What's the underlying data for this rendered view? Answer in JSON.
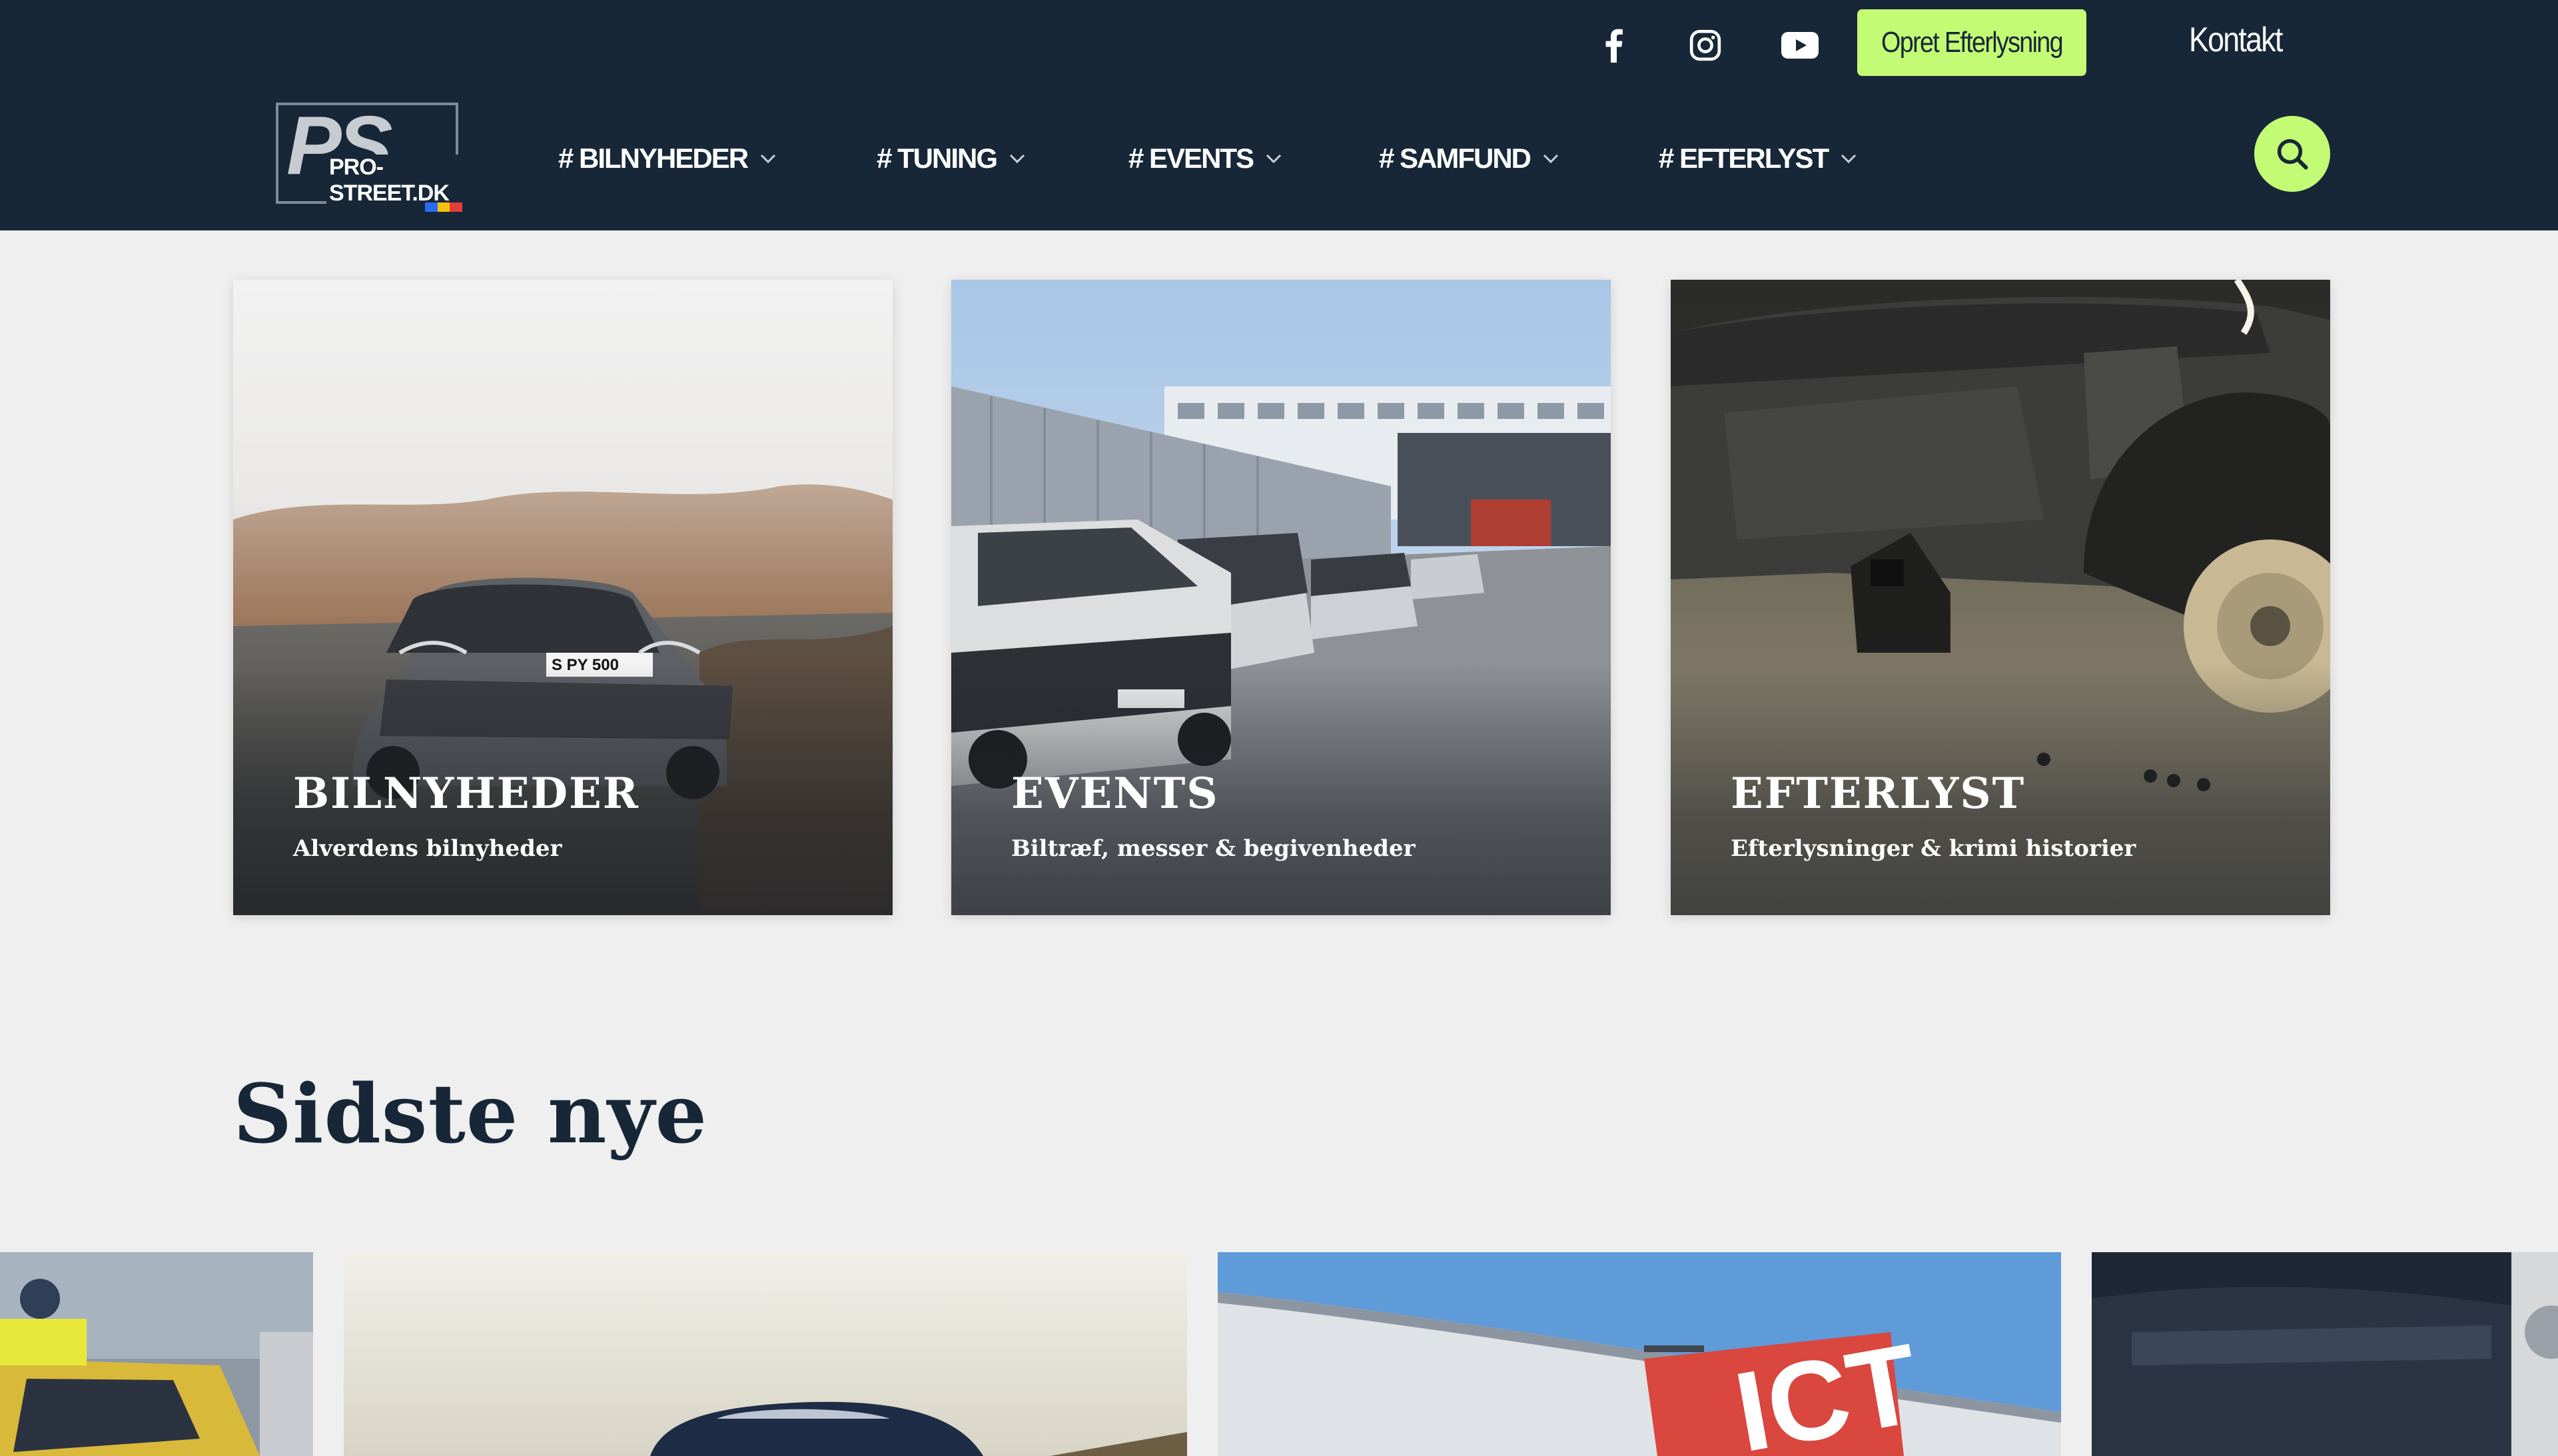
{
  "header": {
    "social": [
      {
        "icon": "facebook-icon"
      },
      {
        "icon": "instagram-icon"
      },
      {
        "icon": "youtube-icon"
      }
    ],
    "cta_label": "Opret Efterlysning",
    "contact_label": "Kontakt",
    "logo": {
      "mark": "PS",
      "text": "PRO-STREET.DK"
    },
    "nav": [
      {
        "label": "# BILNYHEDER"
      },
      {
        "label": "# TUNING"
      },
      {
        "label": "# EVENTS"
      },
      {
        "label": "# SAMFUND"
      },
      {
        "label": "# EFTERLYST"
      }
    ]
  },
  "categories": [
    {
      "title": "BILNYHEDER",
      "subtitle": "Alverdens bilnyheder",
      "plate": "S PY 500"
    },
    {
      "title": "EVENTS",
      "subtitle": "Biltræf, messer & begivenheder"
    },
    {
      "title": "EFTERLYST",
      "subtitle": "Efterlysninger & krimi historier"
    }
  ],
  "latest": {
    "title": "Sidste nye",
    "thumbs": [
      {
        "stamp": "ICT"
      }
    ]
  },
  "colors": {
    "header_bg": "#172738",
    "accent": "#c3fb74",
    "page_bg": "#efefef",
    "heading": "#172738"
  }
}
